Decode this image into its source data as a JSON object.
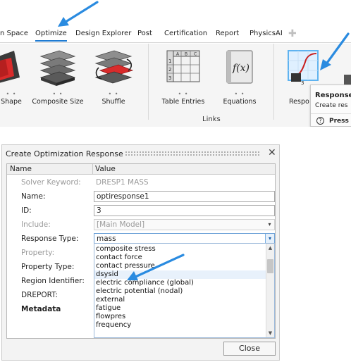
{
  "ribbon": {
    "tabs": [
      {
        "label": "n Space",
        "active": false
      },
      {
        "label": "Optimize",
        "active": true
      },
      {
        "label": "Design Explorer",
        "active": false
      },
      {
        "label": "Post",
        "active": false
      },
      {
        "label": "Certification",
        "active": false
      },
      {
        "label": "Report",
        "active": false
      },
      {
        "label": "PhysicsAI",
        "active": false
      }
    ],
    "tools": [
      {
        "label": "Shape",
        "icon": "shape-icon"
      },
      {
        "label": "Composite Size",
        "icon": "composite-size-icon"
      },
      {
        "label": "Shuffle",
        "icon": "shuffle-icon"
      },
      {
        "label": "Table Entries",
        "icon": "table-entries-icon"
      },
      {
        "label": "Equations",
        "icon": "equations-icon",
        "glyph": "f(x)"
      },
      {
        "label": "Respo",
        "icon": "responses-icon"
      }
    ],
    "group_label": "Links",
    "tooltip": {
      "title": "Response",
      "description": "Create res",
      "help_label": "Press",
      "help_glyph": "?"
    }
  },
  "dialog": {
    "title": "Create Optimization Response",
    "close_glyph": "✕",
    "columns": {
      "name": "Name",
      "value": "Value"
    },
    "rows": {
      "solver_keyword": {
        "label": "Solver Keyword:",
        "value": "DRESP1  MASS"
      },
      "name": {
        "label": "Name:",
        "value": "optiresponse1"
      },
      "id": {
        "label": "ID:",
        "value": "3"
      },
      "include": {
        "label": "Include:",
        "value": "[Main Model]"
      },
      "response_type": {
        "label": "Response Type:",
        "value": "mass"
      },
      "property": {
        "label": "Property:"
      },
      "property_type": {
        "label": "Property Type:"
      },
      "region_identifier": {
        "label": "Region Identifier:"
      },
      "dreport": {
        "label": "DREPORT:"
      },
      "metadata": {
        "label": "Metadata"
      }
    },
    "dropdown_options": [
      "composite stress",
      "contact force",
      "contact pressure",
      "dsysid",
      "electric compliance (global)",
      "electric potential (nodal)",
      "external",
      "fatigue",
      "flowpres",
      "frequency"
    ],
    "highlighted_option": "dsysid",
    "close_button": "Close"
  },
  "colors": {
    "accent": "#1f7bd2",
    "arrow": "#2a8be0",
    "tool_red": "#d92b2b"
  }
}
